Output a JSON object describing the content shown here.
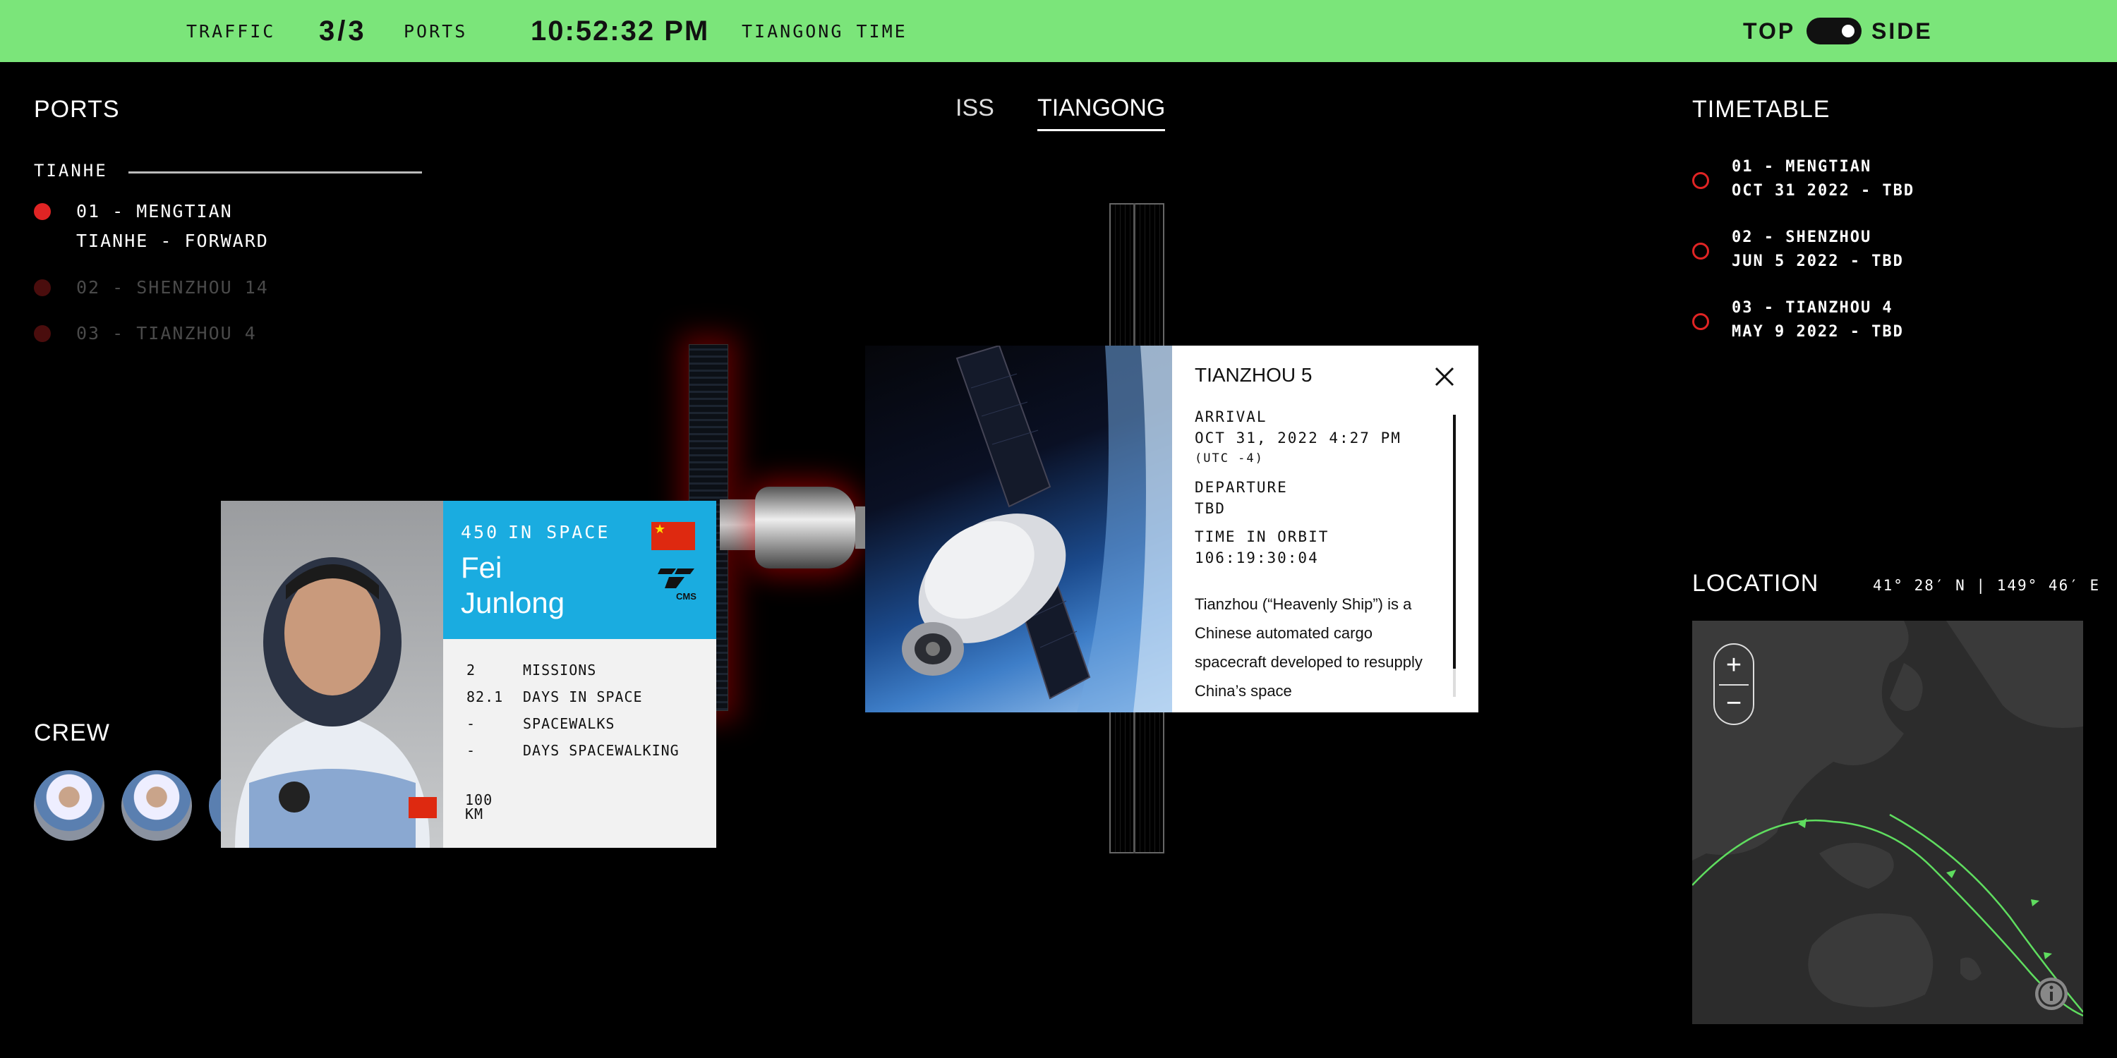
{
  "topbar": {
    "traffic_label": "TRAFFIC",
    "ports_count": "3/3",
    "ports_label": "PORTS",
    "clock": "10:52:32 PM",
    "clock_label": "TIANGONG TIME",
    "view_top": "TOP",
    "view_side": "SIDE",
    "accent": "#7be57a"
  },
  "ports": {
    "title": "PORTS",
    "module": "TIANHE",
    "items": [
      {
        "name": "01 - MENGTIAN",
        "sub": "TIANHE - FORWARD",
        "active": true
      },
      {
        "name": "02 - SHENZHOU 14",
        "active": false
      },
      {
        "name": "03 - TIANZHOU 4",
        "active": false
      }
    ]
  },
  "station_tabs": [
    {
      "label": "ISS",
      "active": false
    },
    {
      "label": "TIANGONG",
      "active": true
    }
  ],
  "timetable": {
    "title": "TIMETABLE",
    "items": [
      {
        "name": "01 - MENGTIAN",
        "date": "OCT 31 2022 - TBD"
      },
      {
        "name": "02 - SHENZHOU",
        "date": "JUN 5 2022 - TBD"
      },
      {
        "name": "03 - TIANZHOU 4",
        "date": "MAY 9 2022 - TBD"
      }
    ]
  },
  "crew": {
    "title": "CREW",
    "card": {
      "days_count": "450",
      "in_space": "IN SPACE",
      "first_name": "Fei",
      "last_name": "Junlong",
      "agency": "CMS",
      "stats": [
        {
          "value": "2",
          "label": "MISSIONS"
        },
        {
          "value": "82.1",
          "label": "DAYS IN SPACE"
        },
        {
          "value": "-",
          "label": "SPACEWALKS"
        },
        {
          "value": "-",
          "label": "DAYS SPACEWALKING"
        }
      ],
      "logo_line1": "100",
      "logo_line2": "KM",
      "header_color": "#1aace0"
    }
  },
  "info": {
    "title": "TIANZHOU 5",
    "arrival_label": "ARRIVAL",
    "arrival_value": "OCT 31, 2022 4:27 PM",
    "arrival_tz": "(UTC -4)",
    "departure_label": "DEPARTURE",
    "departure_value": "TBD",
    "orbit_label": "TIME IN ORBIT",
    "orbit_value": "106:19:30:04",
    "description": "Tianzhou (“Heavenly Ship”) is a Chinese automated cargo spacecraft developed to resupply China’s space"
  },
  "location": {
    "title": "LOCATION",
    "coords": "41° 28′ N | 149° 46′ E",
    "zoom_in": "+",
    "zoom_out": "−"
  },
  "icons": {
    "close": "close-icon",
    "info": "info-icon",
    "zoom_in": "plus-icon",
    "zoom_out": "minus-icon"
  }
}
